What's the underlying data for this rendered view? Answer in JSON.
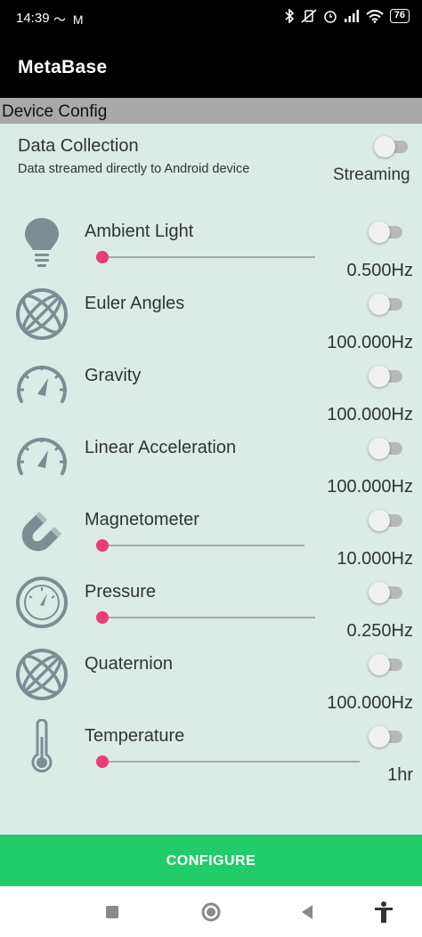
{
  "status_bar": {
    "time": "14:39",
    "left_icons": "〜 M",
    "right_icons": [
      "bluetooth-icon",
      "vibrate-icon",
      "alarm-icon",
      "signal-icon",
      "wifi-icon"
    ],
    "battery": "76"
  },
  "app_bar": {
    "title": "MetaBase"
  },
  "section": {
    "title": "Device Config"
  },
  "data_collection": {
    "title": "Data Collection",
    "subtitle": "Data streamed directly to Android device",
    "mode": "Streaming",
    "enabled": false
  },
  "sensors": [
    {
      "label": "Ambient Light",
      "icon": "lightbulb-icon",
      "freq": "0.500Hz",
      "enabled": false,
      "slider": true,
      "slider_value": 0
    },
    {
      "label": "Euler Angles",
      "icon": "gyro-icon",
      "freq": "100.000Hz",
      "enabled": false,
      "slider": false
    },
    {
      "label": "Gravity",
      "icon": "speedometer-icon",
      "freq": "100.000Hz",
      "enabled": false,
      "slider": false
    },
    {
      "label": "Linear Acceleration",
      "icon": "speedometer-icon",
      "freq": "100.000Hz",
      "enabled": false,
      "slider": false
    },
    {
      "label": "Magnetometer",
      "icon": "magnet-icon",
      "freq": "10.000Hz",
      "enabled": false,
      "slider": true,
      "slider_value": 0
    },
    {
      "label": "Pressure",
      "icon": "pressure-gauge-icon",
      "freq": "0.250Hz",
      "enabled": false,
      "slider": true,
      "slider_value": 0
    },
    {
      "label": "Quaternion",
      "icon": "gyro-icon",
      "freq": "100.000Hz",
      "enabled": false,
      "slider": false
    },
    {
      "label": "Temperature",
      "icon": "thermometer-icon",
      "freq": "1hr",
      "enabled": false,
      "slider": true,
      "slider_value": 0
    }
  ],
  "configure_button": {
    "label": "CONFIGURE"
  },
  "nav": [
    "recent-apps-icon",
    "home-icon",
    "back-icon",
    "accessibility-icon"
  ],
  "colors": {
    "content_bg": "#dcebe6",
    "section_header": "#a9a9a9",
    "accent": "#ec3c76",
    "configure": "#23cc6b",
    "icon": "#7e8c94"
  }
}
